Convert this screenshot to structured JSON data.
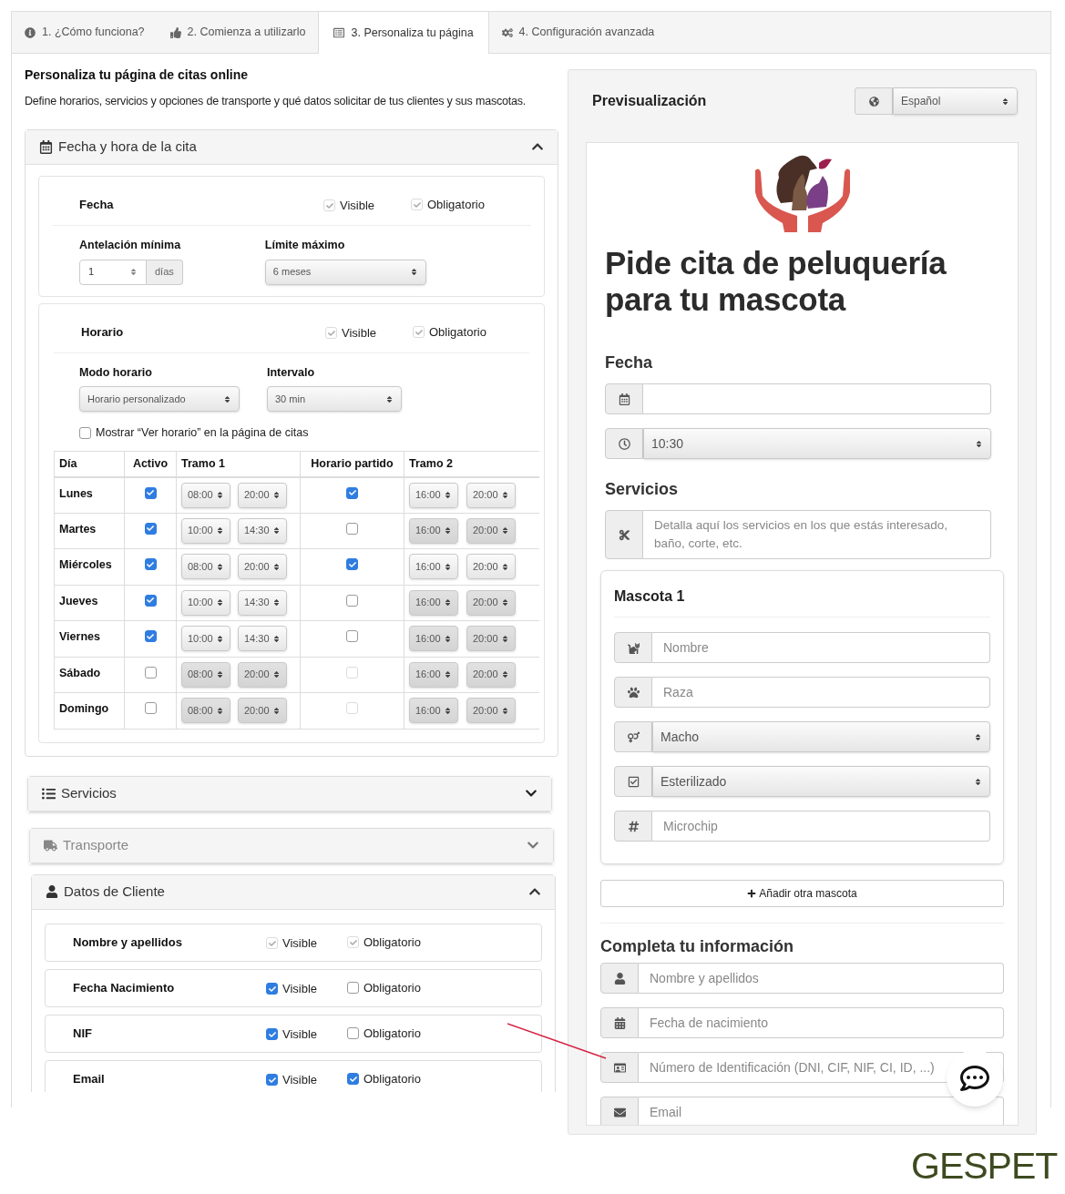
{
  "tabs": [
    {
      "label": "1. ¿Cómo funciona?",
      "selected": false
    },
    {
      "label": "2. Comienza a utilizarlo",
      "selected": false
    },
    {
      "label": "3. Personaliza tu página",
      "selected": true
    },
    {
      "label": "4. Configuración avanzada",
      "selected": false
    }
  ],
  "page_title": "Personaliza tu página de citas online",
  "page_description": "Define horarios, servicios y opciones de transporte y qué datos solicitar de tus clientes y sus mascotas.",
  "fecha_hora": {
    "title": "Fecha y hora de la cita",
    "expanded": true,
    "fecha": {
      "label": "Fecha",
      "visible": {
        "label": "Visible",
        "checked": true,
        "disabled": true
      },
      "required": {
        "label": "Obligatorio",
        "checked": true,
        "disabled": true
      }
    },
    "antelacion": {
      "label": "Antelación mínima",
      "value": "1",
      "unit": "días"
    },
    "limite": {
      "label": "Límite máximo",
      "value": "6 meses"
    },
    "horario": {
      "label": "Horario",
      "visible": {
        "label": "Visible",
        "checked": true,
        "disabled": true
      },
      "required": {
        "label": "Obligatorio",
        "checked": true,
        "disabled": true
      }
    },
    "modo": {
      "label": "Modo horario",
      "value": "Horario personalizado"
    },
    "intervalo": {
      "label": "Intervalo",
      "value": "30 min"
    },
    "ver_horario": {
      "label": "Mostrar “Ver horario” en la página de citas",
      "checked": false
    },
    "table": {
      "columns": [
        "Día",
        "Activo",
        "Tramo 1",
        "Horario partido",
        "Tramo 2"
      ],
      "rows": [
        {
          "day": "Lunes",
          "active": true,
          "tramo1": [
            "08:00",
            "20:00"
          ],
          "split": true,
          "tramo2": [
            "16:00",
            "20:00"
          ]
        },
        {
          "day": "Martes",
          "active": true,
          "tramo1": [
            "10:00",
            "14:30"
          ],
          "split": false,
          "tramo2": [
            "16:00",
            "20:00"
          ]
        },
        {
          "day": "Miércoles",
          "active": true,
          "tramo1": [
            "08:00",
            "20:00"
          ],
          "split": true,
          "tramo2": [
            "16:00",
            "20:00"
          ]
        },
        {
          "day": "Jueves",
          "active": true,
          "tramo1": [
            "10:00",
            "14:30"
          ],
          "split": false,
          "tramo2": [
            "16:00",
            "20:00"
          ]
        },
        {
          "day": "Viernes",
          "active": true,
          "tramo1": [
            "10:00",
            "14:30"
          ],
          "split": false,
          "tramo2": [
            "16:00",
            "20:00"
          ]
        },
        {
          "day": "Sábado",
          "active": false,
          "tramo1": [
            "08:00",
            "20:00"
          ],
          "split": false,
          "tramo2": [
            "16:00",
            "20:00"
          ]
        },
        {
          "day": "Domingo",
          "active": false,
          "tramo1": [
            "08:00",
            "20:00"
          ],
          "split": false,
          "tramo2": [
            "16:00",
            "20:00"
          ]
        }
      ]
    }
  },
  "servicios": {
    "title": "Servicios",
    "expanded": false
  },
  "transporte": {
    "title": "Transporte",
    "expanded": false,
    "disabled": true
  },
  "datos_cliente": {
    "title": "Datos de Cliente",
    "expanded": true,
    "fields": [
      {
        "label": "Nombre y apellidos",
        "visible": {
          "label": "Visible",
          "checked": true,
          "disabled": true
        },
        "required": {
          "label": "Obligatorio",
          "checked": true,
          "disabled": true
        }
      },
      {
        "label": "Fecha Nacimiento",
        "visible": {
          "label": "Visible",
          "checked": true,
          "disabled": false
        },
        "required": {
          "label": "Obligatorio",
          "checked": false,
          "disabled": false
        }
      },
      {
        "label": "NIF",
        "visible": {
          "label": "Visible",
          "checked": true,
          "disabled": false
        },
        "required": {
          "label": "Obligatorio",
          "checked": false,
          "disabled": false
        }
      },
      {
        "label": "Email",
        "visible": {
          "label": "Visible",
          "checked": true,
          "disabled": false
        },
        "required": {
          "label": "Obligatorio",
          "checked": true,
          "disabled": false
        }
      }
    ]
  },
  "preview": {
    "title": "Previsualización",
    "language": "Español",
    "heading": "Pide cita de peluquería para tu mascota",
    "fecha_label": "Fecha",
    "time": "10:30",
    "servicios_label": "Servicios",
    "servicios_placeholder": "Detalla aquí los servicios en los que estás interesado, baño, corte, etc.",
    "mascota": {
      "title": "Mascota 1",
      "fields": [
        {
          "kind": "input",
          "placeholder": "Nombre"
        },
        {
          "kind": "input",
          "placeholder": "Raza"
        },
        {
          "kind": "select",
          "value": "Macho"
        },
        {
          "kind": "select",
          "value": "Esterilizado"
        },
        {
          "kind": "input",
          "placeholder": "Microchip"
        }
      ]
    },
    "add_button": "Añadir otra mascota",
    "cliente_title": "Completa tu información",
    "cliente_fields": [
      {
        "placeholder": "Nombre y apellidos"
      },
      {
        "placeholder": "Fecha de nacimiento"
      },
      {
        "placeholder": "Número de Identificación (DNI, CIF, NIF, CI, ID, ...)"
      },
      {
        "placeholder": "Email"
      }
    ]
  },
  "brand": "GESPET"
}
